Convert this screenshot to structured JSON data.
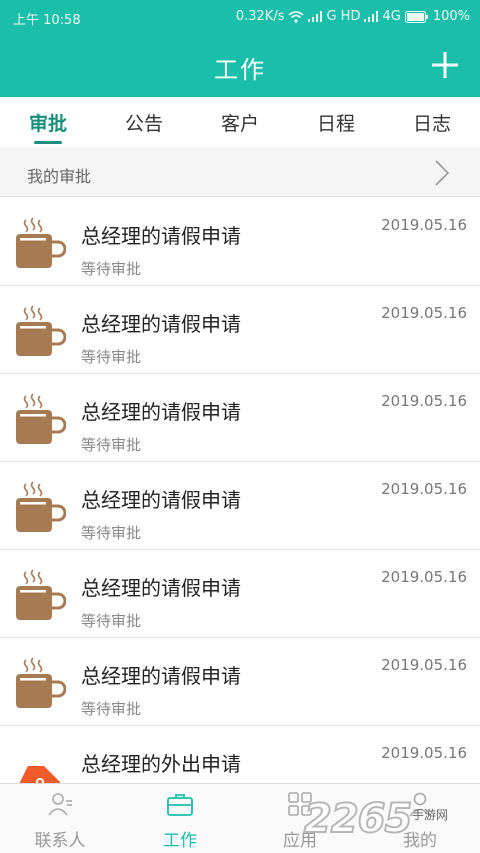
{
  "statusbar": {
    "time": "上午 10:58",
    "network_speed": "0.32K/s",
    "carrier_labels": "G HD",
    "network_type": "4G",
    "battery": "100%"
  },
  "header": {
    "title": "工作",
    "add_icon": "plus-icon",
    "background": "#1bbfa9"
  },
  "tabs": [
    {
      "label": "审批",
      "active": true
    },
    {
      "label": "公告",
      "active": false
    },
    {
      "label": "客户",
      "active": false
    },
    {
      "label": "日程",
      "active": false
    },
    {
      "label": "日志",
      "active": false
    }
  ],
  "subheader": {
    "label": "我的审批",
    "icon": "chevron-right-icon"
  },
  "list": [
    {
      "title": "总经理的请假申请",
      "status": "等待审批",
      "date": "2019.05.16",
      "icon": "coffee-cup-icon"
    },
    {
      "title": "总经理的请假申请",
      "status": "等待审批",
      "date": "2019.05.16",
      "icon": "coffee-cup-icon"
    },
    {
      "title": "总经理的请假申请",
      "status": "等待审批",
      "date": "2019.05.16",
      "icon": "coffee-cup-icon"
    },
    {
      "title": "总经理的请假申请",
      "status": "等待审批",
      "date": "2019.05.16",
      "icon": "coffee-cup-icon"
    },
    {
      "title": "总经理的请假申请",
      "status": "等待审批",
      "date": "2019.05.16",
      "icon": "coffee-cup-icon"
    },
    {
      "title": "总经理的请假申请",
      "status": "等待审批",
      "date": "2019.05.16",
      "icon": "coffee-cup-icon"
    },
    {
      "title": "总经理的外出申请",
      "status": "",
      "date": "2019.05.16",
      "icon": "tag-icon"
    }
  ],
  "tabbar": [
    {
      "label": "联系人",
      "icon": "contacts-icon",
      "active": false
    },
    {
      "label": "工作",
      "icon": "briefcase-icon",
      "active": true
    },
    {
      "label": "应用",
      "icon": "apps-grid-icon",
      "active": false
    },
    {
      "label": "我的",
      "icon": "user-icon",
      "active": false
    }
  ],
  "watermark": {
    "number": "2265",
    "text": "手游网"
  },
  "colors": {
    "accent": "#1bbfa9",
    "tab_active": "#1a8f80",
    "cup": "#a87a52",
    "tag": "#f15a29"
  }
}
